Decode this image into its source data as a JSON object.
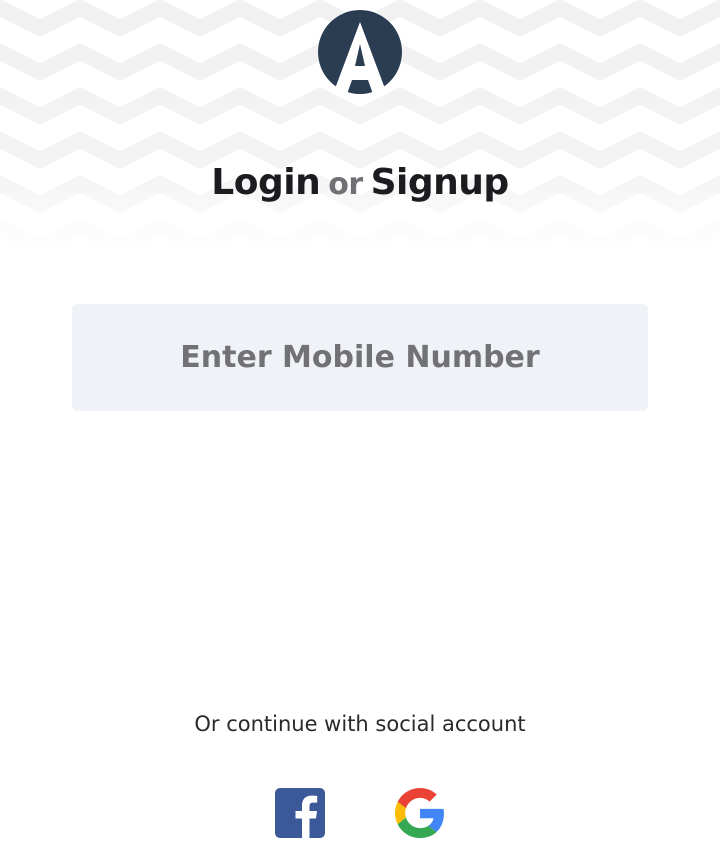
{
  "header": {
    "login_label": "Login",
    "or_label": "or",
    "signup_label": "Signup"
  },
  "mobile_input": {
    "placeholder": "Enter Mobile Number",
    "value": ""
  },
  "social": {
    "caption": "Or continue with social account",
    "providers": [
      {
        "icon": "facebook-icon",
        "color": "#3b5998"
      },
      {
        "icon": "google-icon",
        "colors": [
          "#ea4335",
          "#fbbc05",
          "#34a853",
          "#4285f4"
        ]
      }
    ]
  },
  "colors": {
    "logo": "#2b3d52",
    "title": "#1b1c1f",
    "input_bg": "#eff2f6",
    "pattern": "#f2f2f2"
  }
}
